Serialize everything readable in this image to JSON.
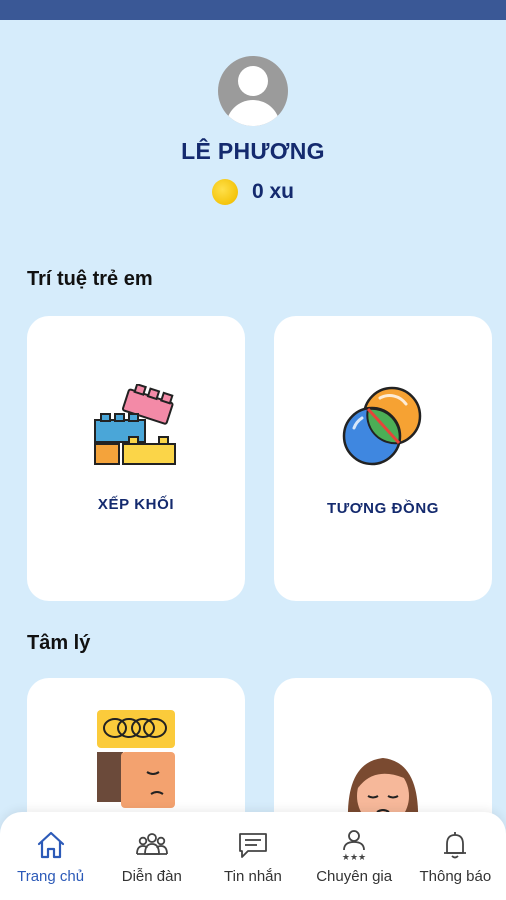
{
  "profile": {
    "name": "LÊ PHƯƠNG",
    "coins": "0 xu"
  },
  "sections": [
    {
      "title": "Trí tuệ trẻ em",
      "cards": [
        {
          "label": "XẾP KHỐI",
          "icon": "blocks-icon"
        },
        {
          "label": "TƯƠNG ĐỒNG",
          "icon": "overlap-circles-icon"
        }
      ]
    },
    {
      "title": "Tâm lý",
      "cards": [
        {
          "label": "",
          "icon": "thinking-man-icon"
        },
        {
          "label": "",
          "icon": "sad-woman-icon"
        }
      ]
    }
  ],
  "tabs": [
    {
      "label": "Trang chủ",
      "icon": "home-icon",
      "active": true
    },
    {
      "label": "Diễn đàn",
      "icon": "forum-icon"
    },
    {
      "label": "Tin nhắn",
      "icon": "message-icon"
    },
    {
      "label": "Chuyên gia",
      "icon": "expert-icon"
    },
    {
      "label": "Thông báo",
      "icon": "bell-icon"
    }
  ],
  "colors": {
    "background": "#d6ecfb",
    "accent": "#2c5ab8",
    "title": "#142a6e"
  }
}
